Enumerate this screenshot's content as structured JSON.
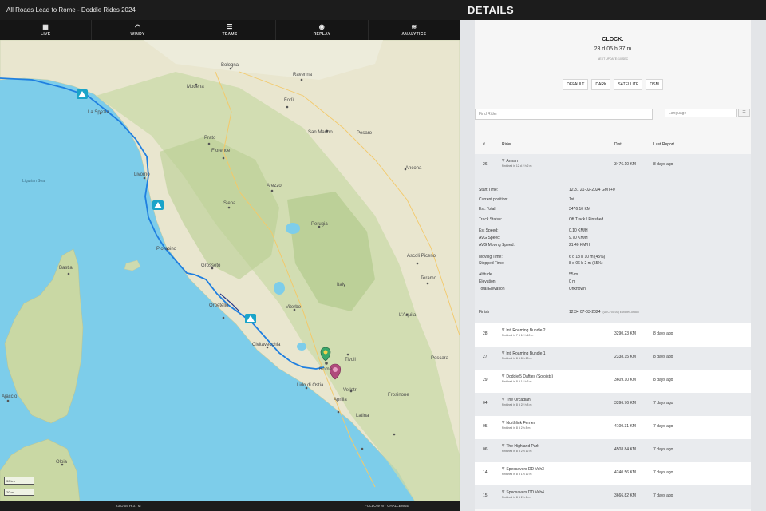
{
  "app": {
    "title": "All Roads Lead to Rome - Doddie Rides 2024"
  },
  "nav": [
    {
      "label": "LIVE",
      "icon": "map-icon"
    },
    {
      "label": "WINDY",
      "icon": "wind-gauge-icon"
    },
    {
      "label": "TEAMS",
      "icon": "list-icon"
    },
    {
      "label": "REPLAY",
      "icon": "replay-icon"
    },
    {
      "label": "ANALYTICS",
      "icon": "analytics-icon"
    }
  ],
  "map": {
    "sea_labels": [
      "Ligurian Sea"
    ],
    "places": [
      "Modena",
      "Bologna",
      "Ravenna",
      "Forlì",
      "La Spezia",
      "Livorno",
      "San Marino",
      "Pesaro",
      "Prato",
      "Florence",
      "Ancona",
      "Arezzo",
      "Siena",
      "Perugia",
      "Grosseto",
      "Piombino",
      "Ascoli Piceno",
      "Teramo",
      "Italy",
      "Orbetello",
      "Viterbo",
      "L'Aquila",
      "Civitavecchia",
      "Rome",
      "Tivoli",
      "Lido di Ostia",
      "Velletri",
      "Aprilia",
      "Latina",
      "Frosinone",
      "Bastia",
      "Ajaccio",
      "Olbia",
      "Pescara"
    ],
    "scale_km": "30 km",
    "scale_mi": "20 mi"
  },
  "bottom": {
    "clock": "23 D 05 H 37 M",
    "follow": "FOLLOW MY CHALLENGE"
  },
  "details": {
    "heading": "DETAILS",
    "clock_label": "CLOCK:",
    "clock_value": "23 d 05 h 37 m",
    "next_update": "NEXT UPDATE: 10 SEC",
    "map_styles": [
      "DEFAULT",
      "DARK",
      "SATELLITE",
      "OSM"
    ],
    "find_placeholder": "Find Rider",
    "language_placeholder": "Language",
    "columns": [
      "#",
      "Rider",
      "Dist.",
      "Last Report"
    ],
    "selected": {
      "num": "26",
      "rider": "Annan",
      "finished": "Finished in 12 d 2 h 2 m",
      "dist": "3476.10 KM",
      "last": "8 days ago"
    },
    "fields": [
      {
        "label": "Start Time:",
        "value": "12:31 21-02-2024 GMT+0"
      },
      {
        "label": "Current position:",
        "value": "1st"
      },
      {
        "label": "Est. Total:",
        "value": "3476.10 KM"
      },
      {
        "label": "Track Status:",
        "value": "Off Track / Finished"
      },
      {
        "label": "Est Speed:",
        "value": "0.10 KM/H"
      },
      {
        "label": "AVG Speed:",
        "value": "9.70 KM/H"
      },
      {
        "label": "AVG Moving Speed:",
        "value": "21.40 KM/H"
      },
      {
        "label": "Moving Time:",
        "value": "6 d 18 h 10 m (45%)"
      },
      {
        "label": "Stopped Time:",
        "value": "8 d 06 h 2 m (55%)"
      },
      {
        "label": "Altitude",
        "value": "55 m"
      },
      {
        "label": "Elevation",
        "value": "0 m"
      },
      {
        "label": "Total Elevation",
        "value": "Unknown"
      }
    ],
    "finish_label": "Finish",
    "finish_value": "12:34 07-03-2024",
    "finish_note": "(UTC+00:00) Europe/London",
    "riders": [
      {
        "num": "28",
        "name": "Inti Roaming Bundle 2",
        "finished": "Finished in 7 d 12 h 10 m",
        "dist": "3290.23 KM",
        "last": "8 days ago"
      },
      {
        "num": "27",
        "name": "Inti Roaming Bundle 1",
        "finished": "Finished in 8 d 8 h 23 m",
        "dist": "2338.15 KM",
        "last": "8 days ago"
      },
      {
        "num": "29",
        "name": "Doddie'5 Dafties (Soloists)",
        "finished": "Finished in 8 d 14 h 3 m",
        "dist": "3609.10 KM",
        "last": "8 days ago"
      },
      {
        "num": "04",
        "name": "The Orcadian",
        "finished": "Finished in 8 d 22 h 8 m",
        "dist": "3396.76 KM",
        "last": "7 days ago"
      },
      {
        "num": "05",
        "name": "Northlink Ferries",
        "finished": "Finished in 8 d 2 h 8 m",
        "dist": "4100.31 KM",
        "last": "7 days ago"
      },
      {
        "num": "06",
        "name": "The Highland Park",
        "finished": "Finished in 8 d 2 h 12 m",
        "dist": "4508.84 KM",
        "last": "7 days ago"
      },
      {
        "num": "14",
        "name": "Specsavers DD Veh3",
        "finished": "Finished in 8 d 1 h 12 m",
        "dist": "4240.56 KM",
        "last": "7 days ago"
      },
      {
        "num": "15",
        "name": "Specsavers DD Veh4",
        "finished": "Finished in 8 d 2 h 6 m",
        "dist": "3666.82 KM",
        "last": "7 days ago"
      }
    ]
  }
}
